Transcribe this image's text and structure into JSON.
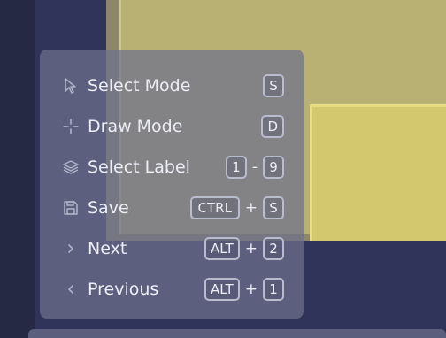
{
  "shortcuts": [
    {
      "label": "Select Mode",
      "icon": "cursor-arrow-icon",
      "keys": [
        "S"
      ],
      "separator": ""
    },
    {
      "label": "Draw Mode",
      "icon": "crosshair-icon",
      "keys": [
        "D"
      ],
      "separator": ""
    },
    {
      "label": "Select Label",
      "icon": "layers-icon",
      "keys": [
        "1",
        "9"
      ],
      "separator": "-"
    },
    {
      "label": "Save",
      "icon": "floppy-disk-icon",
      "keys": [
        "CTRL",
        "S"
      ],
      "separator": "+"
    },
    {
      "label": "Next",
      "icon": "chevron-right-icon",
      "keys": [
        "ALT",
        "2"
      ],
      "separator": "+"
    },
    {
      "label": "Previous",
      "icon": "chevron-left-icon",
      "keys": [
        "ALT",
        "1"
      ],
      "separator": "+"
    }
  ],
  "colors": {
    "panel_bg": "#6e728c",
    "annotation_fill": "#d4c86f",
    "canvas_bg": "#30345a"
  }
}
